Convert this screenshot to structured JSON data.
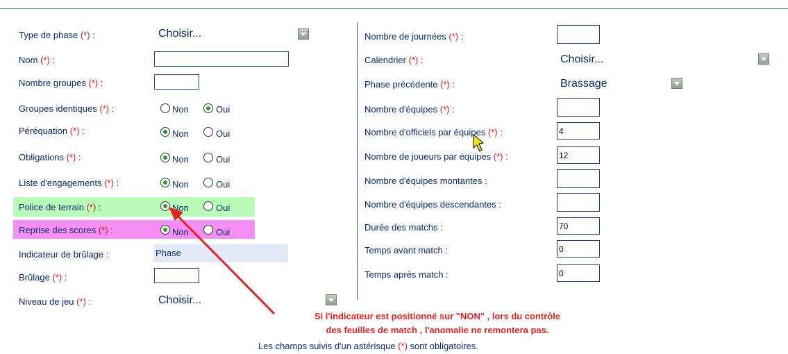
{
  "required_marker": "(*)",
  "left": {
    "type_phase": {
      "label": "Type de phase",
      "value": "Choisir...",
      "sep": " :"
    },
    "nom": {
      "label": "Nom",
      "value": "",
      "sep": " :"
    },
    "nombre_groupes": {
      "label": "Nombre groupes",
      "value": "",
      "sep": " :"
    },
    "groupes_identiques": {
      "label": "Groupes identiques",
      "sep": " :",
      "selected": "Oui"
    },
    "perequation": {
      "label": "Péréquation",
      "sep": " :",
      "selected": "Non"
    },
    "obligations": {
      "label": "Obligations",
      "sep": " :",
      "selected": "Non"
    },
    "liste_engagements": {
      "label": "Liste d'engagements",
      "sep": " :",
      "selected": "Non"
    },
    "police_terrain": {
      "label": "Police de terrain",
      "sep": " :",
      "selected": "Non"
    },
    "reprise_scores": {
      "label": "Reprise des scores",
      "sep": " :",
      "selected": "Non"
    },
    "indicateur_brulage": {
      "label": "Indicateur de brûlage :",
      "value": "Phase"
    },
    "brulage": {
      "label": "Brûlage",
      "value": "",
      "sep": " :"
    },
    "niveau_jeu": {
      "label": "Niveau de jeu",
      "value": "Choisir...",
      "sep": " :"
    }
  },
  "radio_labels": {
    "non": "Non",
    "oui": "Oui"
  },
  "right": {
    "nombre_journees": {
      "label": "Nombre de journées",
      "value": "",
      "sep": " :"
    },
    "calendrier": {
      "label": "Calendrier",
      "value": "Choisir...",
      "sep": " :"
    },
    "phase_precedente": {
      "label": "Phase précédente",
      "value": "Brassage",
      "sep": " :"
    },
    "nombre_equipes": {
      "label": "Nombre d'équipes",
      "value": "",
      "sep": " :"
    },
    "nombre_officiels": {
      "label": "Nombre d'officiels par équipes",
      "value": "4",
      "sep": " :"
    },
    "nombre_joueurs": {
      "label": "Nombre de joueurs par équipes",
      "value": "12",
      "sep": " :"
    },
    "equipes_montantes": {
      "label": "Nombre d'équipes montantes :",
      "value": ""
    },
    "equipes_descendantes": {
      "label": "Nombre d'équipes descendantes :",
      "value": ""
    },
    "duree_matchs": {
      "label": "Durée des matchs :",
      "value": "70"
    },
    "temps_avant": {
      "label": "Temps avant match :",
      "value": "0"
    },
    "temps_apres": {
      "label": "Temps après match :",
      "value": "0"
    }
  },
  "annotation": {
    "line1": "Si l'indicateur est positionné sur \"NON\" , lors du contrôle",
    "line2": "des feuilles de match , l'anomalie ne remontera pas.",
    "color": "#e82020"
  },
  "footer": {
    "before": "Les champs suivis d'un astérisque ",
    "marker": "(*)",
    "after": " sont obligatoires."
  },
  "colors": {
    "label": "#0a2a6b",
    "required": "#e01515",
    "highlight_green": "#b9fbb9",
    "highlight_pink": "#f58ff5",
    "divider": "#2a5cab"
  }
}
